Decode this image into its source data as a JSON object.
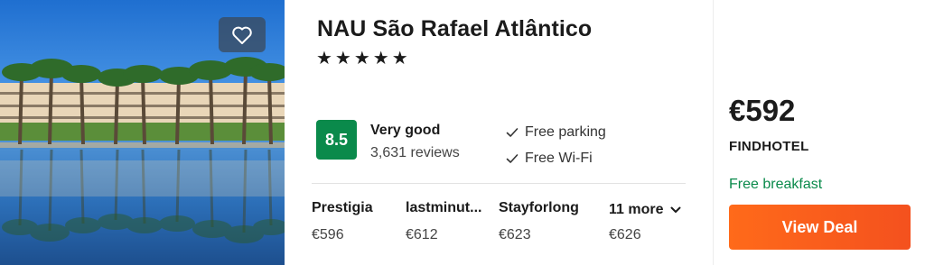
{
  "hotel": {
    "name": "NAU São Rafael Atlântico",
    "stars": "★★★★★",
    "favorite_icon": "heart-icon"
  },
  "rating": {
    "score": "8.5",
    "label": "Very good",
    "reviews": "3,631 reviews"
  },
  "amenities": [
    {
      "label": "Free parking",
      "icon": "check-icon"
    },
    {
      "label": "Free Wi-Fi",
      "icon": "check-icon"
    }
  ],
  "providers": [
    {
      "name": "Prestigia",
      "price": "€596"
    },
    {
      "name": "lastminut...",
      "price": "€612"
    },
    {
      "name": "Stayforlong",
      "price": "€623"
    }
  ],
  "more": {
    "label": "11 more",
    "price": "€626",
    "icon": "chevron-down-icon"
  },
  "deal": {
    "price": "€592",
    "seller": "FINDHOTEL",
    "extra": "Free breakfast",
    "button_label": "View Deal"
  },
  "colors": {
    "score_bg": "#0a8a4b",
    "deal_button": "#ff5c1a",
    "breakfast_text": "#0a8a4b"
  }
}
